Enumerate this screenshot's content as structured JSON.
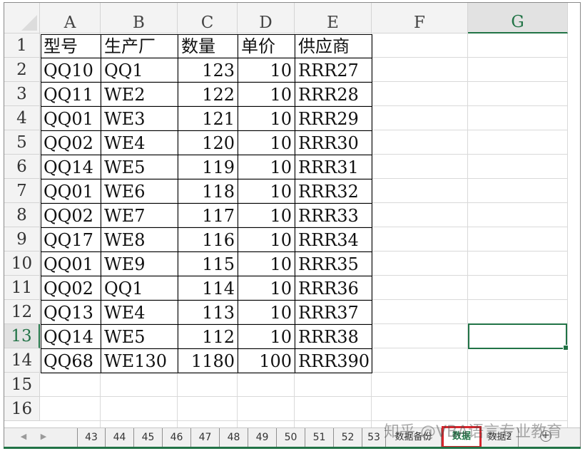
{
  "columns": [
    "A",
    "B",
    "C",
    "D",
    "E",
    "F",
    "G"
  ],
  "selected_column": "G",
  "row_numbers": [
    "1",
    "2",
    "3",
    "4",
    "5",
    "6",
    "7",
    "8",
    "9",
    "10",
    "11",
    "12",
    "13",
    "14",
    "15",
    "16"
  ],
  "selected_row": "13",
  "table": {
    "headers": [
      "型号",
      "生产厂",
      "数量",
      "单价",
      "供应商"
    ],
    "rows": [
      [
        "QQ10",
        "QQ1",
        "123",
        "10",
        "RRR27"
      ],
      [
        "QQ11",
        "WE2",
        "122",
        "10",
        "RRR28"
      ],
      [
        "QQ01",
        "WE3",
        "121",
        "10",
        "RRR29"
      ],
      [
        "QQ02",
        "WE4",
        "120",
        "10",
        "RRR30"
      ],
      [
        "QQ14",
        "WE5",
        "119",
        "10",
        "RRR31"
      ],
      [
        "QQ01",
        "WE6",
        "118",
        "10",
        "RRR32"
      ],
      [
        "QQ02",
        "WE7",
        "117",
        "10",
        "RRR33"
      ],
      [
        "QQ17",
        "WE8",
        "116",
        "10",
        "RRR34"
      ],
      [
        "QQ01",
        "WE9",
        "115",
        "10",
        "RRR35"
      ],
      [
        "QQ02",
        "QQ1",
        "114",
        "10",
        "RRR36"
      ],
      [
        "QQ13",
        "WE4",
        "113",
        "10",
        "RRR37"
      ],
      [
        "QQ14",
        "WE5",
        "112",
        "10",
        "RRR38"
      ],
      [
        "QQ68",
        "WE130",
        "1180",
        "100",
        "RRR390"
      ]
    ]
  },
  "active_cell": "G13",
  "sheet_tabs": [
    "43",
    "44",
    "45",
    "46",
    "47",
    "48",
    "49",
    "50",
    "51",
    "52",
    "53",
    "数据备份",
    "数据",
    "数据2"
  ],
  "active_tab": "数据",
  "nav": {
    "prev_icon": "◀",
    "next_icon": "▶",
    "add_sheet_icon": "+"
  },
  "watermark": "知乎 @VBA语言专业教育",
  "colors": {
    "accent": "#217346",
    "highlight_border": "#d6262d"
  }
}
